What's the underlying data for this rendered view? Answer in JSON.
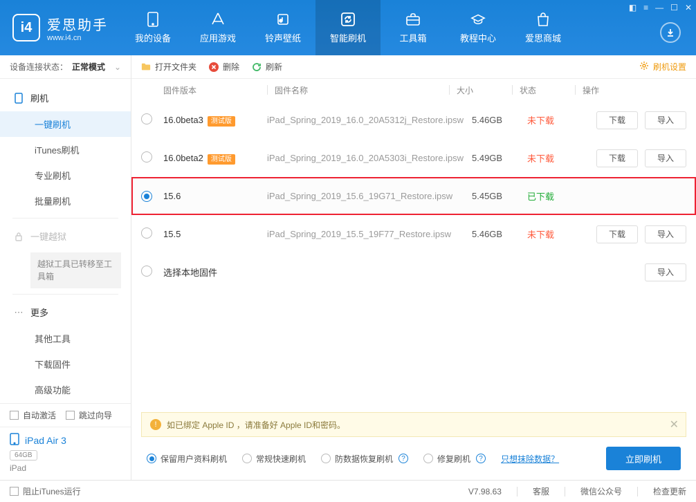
{
  "app": {
    "name": "爱思助手",
    "url": "www.i4.cn"
  },
  "nav": [
    {
      "id": "device",
      "label": "我的设备"
    },
    {
      "id": "apps",
      "label": "应用游戏"
    },
    {
      "id": "ringtones",
      "label": "铃声壁纸"
    },
    {
      "id": "flash",
      "label": "智能刷机"
    },
    {
      "id": "toolbox",
      "label": "工具箱"
    },
    {
      "id": "tutorials",
      "label": "教程中心"
    },
    {
      "id": "store",
      "label": "爱思商城"
    }
  ],
  "sidebar": {
    "status_label": "设备连接状态：",
    "status_value": "正常模式",
    "groups": {
      "flash": {
        "label": "刷机",
        "items": [
          "一键刷机",
          "iTunes刷机",
          "专业刷机",
          "批量刷机"
        ]
      },
      "jailbreak": {
        "label": "一键越狱"
      },
      "jailbreak_notice": "越狱工具已转移至工具箱",
      "more": {
        "label": "更多",
        "items": [
          "其他工具",
          "下载固件",
          "高级功能"
        ]
      }
    },
    "auto_activate": "自动激活",
    "skip_guide": "跳过向导",
    "device_name": "iPad Air 3",
    "device_capacity": "64GB",
    "device_type": "iPad"
  },
  "toolbar": {
    "open_folder": "打开文件夹",
    "delete": "删除",
    "refresh": "刷新",
    "settings": "刷机设置"
  },
  "table": {
    "headers": {
      "version": "固件版本",
      "name": "固件名称",
      "size": "大小",
      "status": "状态",
      "ops": "操作"
    },
    "badge": "测试版",
    "btn_download": "下载",
    "btn_import": "导入",
    "status_not": "未下载",
    "status_done": "已下载",
    "select_local": "选择本地固件",
    "rows": [
      {
        "ver": "16.0beta3",
        "beta": true,
        "name": "iPad_Spring_2019_16.0_20A5312j_Restore.ipsw",
        "size": "5.46GB",
        "status": "not",
        "ops": true
      },
      {
        "ver": "16.0beta2",
        "beta": true,
        "name": "iPad_Spring_2019_16.0_20A5303i_Restore.ipsw",
        "size": "5.49GB",
        "status": "not",
        "ops": true
      },
      {
        "ver": "15.6",
        "beta": false,
        "name": "iPad_Spring_2019_15.6_19G71_Restore.ipsw",
        "size": "5.45GB",
        "status": "done",
        "ops": false,
        "selected": true
      },
      {
        "ver": "15.5",
        "beta": false,
        "name": "iPad_Spring_2019_15.5_19F77_Restore.ipsw",
        "size": "5.46GB",
        "status": "not",
        "ops": true
      }
    ]
  },
  "info": "如已绑定 Apple ID ，请准备好 Apple ID和密码。",
  "options": {
    "keep_data": "保留用户资料刷机",
    "regular": "常规快速刷机",
    "anti_recovery": "防数据恢复刷机",
    "repair": "修复刷机",
    "erase_link": "只想抹除数据？",
    "go": "立即刷机"
  },
  "footer": {
    "block_itunes": "阻止iTunes运行",
    "version": "V7.98.63",
    "support": "客服",
    "wechat": "微信公众号",
    "update": "检查更新"
  }
}
